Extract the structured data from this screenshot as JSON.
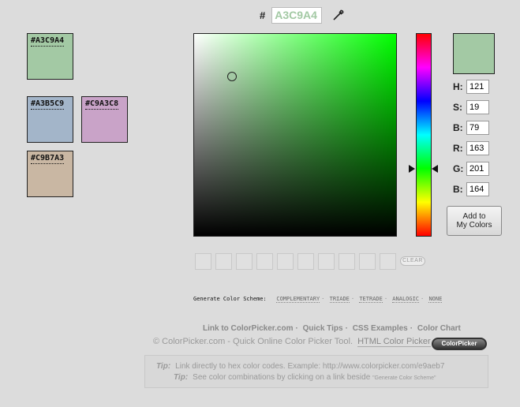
{
  "hex": {
    "hash": "#",
    "value": "A3C9A4"
  },
  "saved_swatches": [
    {
      "label": "#A3C9A4",
      "color": "#A3C9A4"
    },
    {
      "label": "#A3B5C9",
      "color": "#A3B5C9"
    },
    {
      "label": "#C9A3C8",
      "color": "#C9A3C8"
    },
    {
      "label": "#C9B7A3",
      "color": "#C9B7A3"
    }
  ],
  "picker": {
    "hue_color": "#00ff00",
    "preview_color": "#A3C9A4"
  },
  "fields": {
    "h": {
      "label": "H:",
      "value": "121"
    },
    "s": {
      "label": "S:",
      "value": "19"
    },
    "b": {
      "label": "B:",
      "value": "79"
    },
    "r": {
      "label": "R:",
      "value": "163"
    },
    "g": {
      "label": "G:",
      "value": "201"
    },
    "b2": {
      "label": "B:",
      "value": "164"
    }
  },
  "add_button": {
    "line1": "Add to",
    "line2": "My Colors"
  },
  "clear_label": "CLEAR",
  "scheme": {
    "label": "Generate Color Scheme:",
    "options": [
      "COMPLEMENTARY",
      "TRIADE",
      "TETRADE",
      "ANALOGIC",
      "NONE"
    ]
  },
  "footer_links": [
    "Link to ColorPicker.com",
    "Quick Tips",
    "CSS Examples",
    "Color Chart"
  ],
  "credit": {
    "text": "© ColorPicker.com - Quick Online Color Picker Tool.",
    "html_link": "HTML Color Picker",
    "badge": "ColorPicker"
  },
  "tips": [
    {
      "label": "Tip:",
      "text": "Link directly to hex color codes.  Example:  http://www.colorpicker.com/e9aeb7",
      "small": ""
    },
    {
      "label": "Tip:",
      "text": "See color combinations by clicking on a link beside ",
      "small": "\"Generate Color Scheme\""
    }
  ]
}
